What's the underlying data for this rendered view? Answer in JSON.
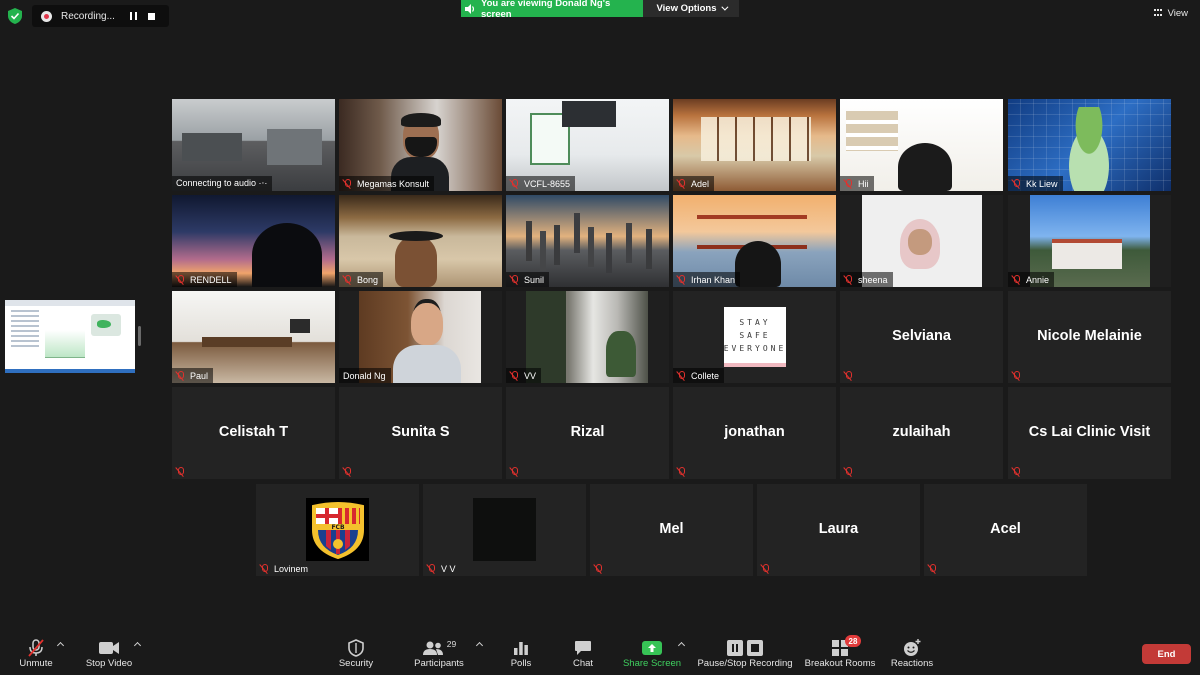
{
  "top_bar": {
    "recording_label": "Recording...",
    "viewing_banner": "You are viewing Donald Ng's screen",
    "view_options_label": "View Options",
    "view_label": "View"
  },
  "tiles": [
    {
      "name": "Connecting to audio ·‧·",
      "video": true,
      "muted": false,
      "scene": "sc-office"
    },
    {
      "name": "Megamas Konsult",
      "video": true,
      "muted": true,
      "scene": "sc-books"
    },
    {
      "name": "VCFL-8655",
      "video": true,
      "muted": true,
      "scene": "sc-room"
    },
    {
      "name": "Adel",
      "video": true,
      "muted": true,
      "scene": "sc-japanese"
    },
    {
      "name": "Hii",
      "video": true,
      "muted": true,
      "scene": "sc-shelf"
    },
    {
      "name": "Kk Liew",
      "video": true,
      "muted": true,
      "scene": "sc-blueprint"
    },
    {
      "name": "RENDELL",
      "video": true,
      "muted": true,
      "scene": "sc-night"
    },
    {
      "name": "Bong",
      "video": true,
      "muted": true,
      "scene": "sc-beach"
    },
    {
      "name": "Sunil",
      "video": true,
      "muted": true,
      "scene": "sc-city"
    },
    {
      "name": "Irhan Khan",
      "video": true,
      "muted": true,
      "scene": "sc-bridge"
    },
    {
      "name": "sheena",
      "video": true,
      "muted": true,
      "scene": "sc-sheena"
    },
    {
      "name": "Annie",
      "video": true,
      "muted": true,
      "scene": "sc-villa"
    },
    {
      "name": "Paul",
      "video": true,
      "muted": true,
      "scene": "sc-paul"
    },
    {
      "name": "Donald Ng",
      "video": true,
      "muted": false,
      "scene": "sc-donald",
      "active": true
    },
    {
      "name": "VV",
      "video": true,
      "muted": true,
      "scene": "sc-vv"
    },
    {
      "name": "Collete",
      "video": true,
      "muted": true,
      "scene": "stay-safe"
    },
    {
      "name": "Selviana",
      "video": false,
      "muted": true
    },
    {
      "name": "Nicole Melainie",
      "video": false,
      "muted": true
    },
    {
      "name": "Celistah T",
      "video": false,
      "muted": true
    },
    {
      "name": "Sunita S",
      "video": false,
      "muted": true
    },
    {
      "name": "Rizal",
      "video": false,
      "muted": true
    },
    {
      "name": "jonathan",
      "video": false,
      "muted": true
    },
    {
      "name": "zulaihah",
      "video": false,
      "muted": true
    },
    {
      "name": "Cs Lai Clinic Visit",
      "video": false,
      "muted": true
    },
    {
      "name": "Lovinem",
      "video": false,
      "muted": true,
      "avatar": "fcb"
    },
    {
      "name": "V V",
      "video": false,
      "muted": true,
      "avatar": "dark"
    },
    {
      "name": "Mel",
      "video": false,
      "muted": true
    },
    {
      "name": "Laura",
      "video": false,
      "muted": true
    },
    {
      "name": "Acel",
      "video": false,
      "muted": true
    }
  ],
  "collete_sign": [
    "STAY",
    "SAFE",
    "EVERYONE"
  ],
  "toolbar": {
    "unmute": "Unmute",
    "stop_video": "Stop Video",
    "security": "Security",
    "participants": "Participants",
    "participants_count": "29",
    "polls": "Polls",
    "chat": "Chat",
    "share_screen": "Share Screen",
    "pause_stop_recording": "Pause/Stop Recording",
    "breakout_rooms": "Breakout Rooms",
    "breakout_badge": "28",
    "reactions": "Reactions",
    "end": "End"
  },
  "colors": {
    "background": "#1a1a1a",
    "tile": "#232323",
    "active_border": "#f2ef8b",
    "banner_green": "#24b34e",
    "share_green": "#37c356",
    "end_red": "#c33a37",
    "mute_red": "#e2312d"
  }
}
